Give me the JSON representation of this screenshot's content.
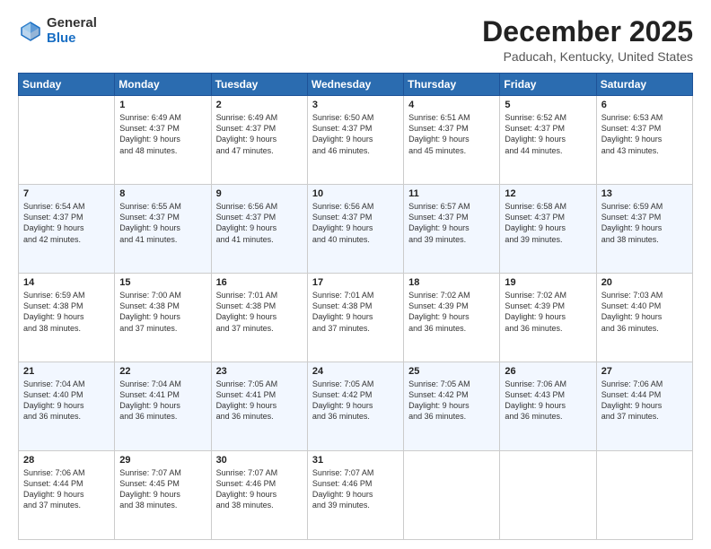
{
  "logo": {
    "general": "General",
    "blue": "Blue"
  },
  "header": {
    "month": "December 2025",
    "location": "Paducah, Kentucky, United States"
  },
  "weekdays": [
    "Sunday",
    "Monday",
    "Tuesday",
    "Wednesday",
    "Thursday",
    "Friday",
    "Saturday"
  ],
  "weeks": [
    [
      {
        "day": "",
        "info": ""
      },
      {
        "day": "1",
        "info": "Sunrise: 6:49 AM\nSunset: 4:37 PM\nDaylight: 9 hours\nand 48 minutes."
      },
      {
        "day": "2",
        "info": "Sunrise: 6:49 AM\nSunset: 4:37 PM\nDaylight: 9 hours\nand 47 minutes."
      },
      {
        "day": "3",
        "info": "Sunrise: 6:50 AM\nSunset: 4:37 PM\nDaylight: 9 hours\nand 46 minutes."
      },
      {
        "day": "4",
        "info": "Sunrise: 6:51 AM\nSunset: 4:37 PM\nDaylight: 9 hours\nand 45 minutes."
      },
      {
        "day": "5",
        "info": "Sunrise: 6:52 AM\nSunset: 4:37 PM\nDaylight: 9 hours\nand 44 minutes."
      },
      {
        "day": "6",
        "info": "Sunrise: 6:53 AM\nSunset: 4:37 PM\nDaylight: 9 hours\nand 43 minutes."
      }
    ],
    [
      {
        "day": "7",
        "info": "Sunrise: 6:54 AM\nSunset: 4:37 PM\nDaylight: 9 hours\nand 42 minutes."
      },
      {
        "day": "8",
        "info": "Sunrise: 6:55 AM\nSunset: 4:37 PM\nDaylight: 9 hours\nand 41 minutes."
      },
      {
        "day": "9",
        "info": "Sunrise: 6:56 AM\nSunset: 4:37 PM\nDaylight: 9 hours\nand 41 minutes."
      },
      {
        "day": "10",
        "info": "Sunrise: 6:56 AM\nSunset: 4:37 PM\nDaylight: 9 hours\nand 40 minutes."
      },
      {
        "day": "11",
        "info": "Sunrise: 6:57 AM\nSunset: 4:37 PM\nDaylight: 9 hours\nand 39 minutes."
      },
      {
        "day": "12",
        "info": "Sunrise: 6:58 AM\nSunset: 4:37 PM\nDaylight: 9 hours\nand 39 minutes."
      },
      {
        "day": "13",
        "info": "Sunrise: 6:59 AM\nSunset: 4:37 PM\nDaylight: 9 hours\nand 38 minutes."
      }
    ],
    [
      {
        "day": "14",
        "info": "Sunrise: 6:59 AM\nSunset: 4:38 PM\nDaylight: 9 hours\nand 38 minutes."
      },
      {
        "day": "15",
        "info": "Sunrise: 7:00 AM\nSunset: 4:38 PM\nDaylight: 9 hours\nand 37 minutes."
      },
      {
        "day": "16",
        "info": "Sunrise: 7:01 AM\nSunset: 4:38 PM\nDaylight: 9 hours\nand 37 minutes."
      },
      {
        "day": "17",
        "info": "Sunrise: 7:01 AM\nSunset: 4:38 PM\nDaylight: 9 hours\nand 37 minutes."
      },
      {
        "day": "18",
        "info": "Sunrise: 7:02 AM\nSunset: 4:39 PM\nDaylight: 9 hours\nand 36 minutes."
      },
      {
        "day": "19",
        "info": "Sunrise: 7:02 AM\nSunset: 4:39 PM\nDaylight: 9 hours\nand 36 minutes."
      },
      {
        "day": "20",
        "info": "Sunrise: 7:03 AM\nSunset: 4:40 PM\nDaylight: 9 hours\nand 36 minutes."
      }
    ],
    [
      {
        "day": "21",
        "info": "Sunrise: 7:04 AM\nSunset: 4:40 PM\nDaylight: 9 hours\nand 36 minutes."
      },
      {
        "day": "22",
        "info": "Sunrise: 7:04 AM\nSunset: 4:41 PM\nDaylight: 9 hours\nand 36 minutes."
      },
      {
        "day": "23",
        "info": "Sunrise: 7:05 AM\nSunset: 4:41 PM\nDaylight: 9 hours\nand 36 minutes."
      },
      {
        "day": "24",
        "info": "Sunrise: 7:05 AM\nSunset: 4:42 PM\nDaylight: 9 hours\nand 36 minutes."
      },
      {
        "day": "25",
        "info": "Sunrise: 7:05 AM\nSunset: 4:42 PM\nDaylight: 9 hours\nand 36 minutes."
      },
      {
        "day": "26",
        "info": "Sunrise: 7:06 AM\nSunset: 4:43 PM\nDaylight: 9 hours\nand 36 minutes."
      },
      {
        "day": "27",
        "info": "Sunrise: 7:06 AM\nSunset: 4:44 PM\nDaylight: 9 hours\nand 37 minutes."
      }
    ],
    [
      {
        "day": "28",
        "info": "Sunrise: 7:06 AM\nSunset: 4:44 PM\nDaylight: 9 hours\nand 37 minutes."
      },
      {
        "day": "29",
        "info": "Sunrise: 7:07 AM\nSunset: 4:45 PM\nDaylight: 9 hours\nand 38 minutes."
      },
      {
        "day": "30",
        "info": "Sunrise: 7:07 AM\nSunset: 4:46 PM\nDaylight: 9 hours\nand 38 minutes."
      },
      {
        "day": "31",
        "info": "Sunrise: 7:07 AM\nSunset: 4:46 PM\nDaylight: 9 hours\nand 39 minutes."
      },
      {
        "day": "",
        "info": ""
      },
      {
        "day": "",
        "info": ""
      },
      {
        "day": "",
        "info": ""
      }
    ]
  ]
}
